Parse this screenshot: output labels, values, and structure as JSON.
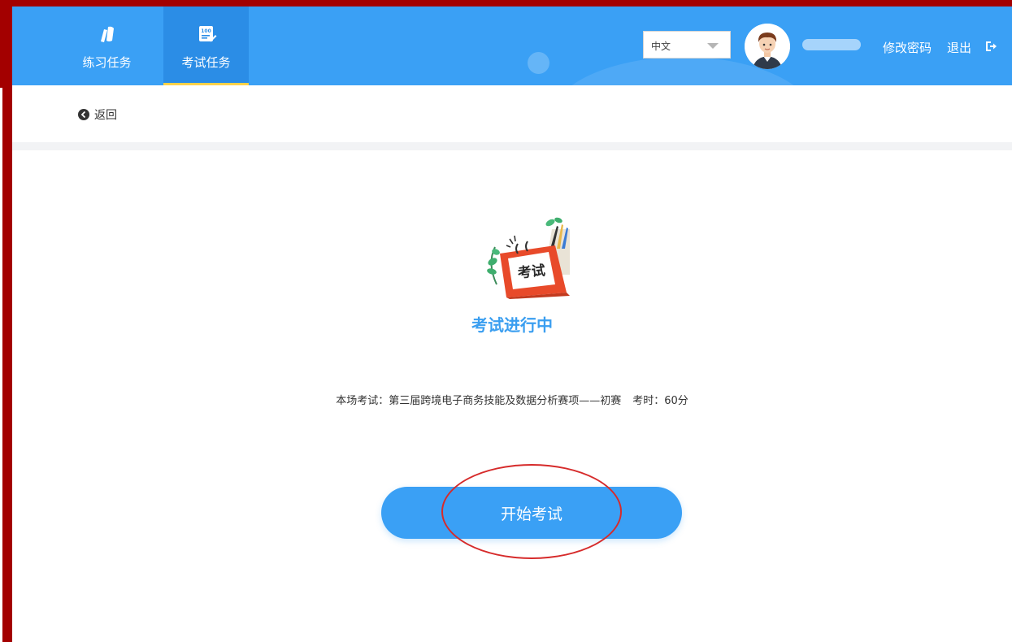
{
  "nav": {
    "tabs": [
      {
        "label": "练习任务",
        "icon": "practice-icon",
        "active": false
      },
      {
        "label": "考试任务",
        "icon": "exam-100-icon",
        "active": true
      }
    ]
  },
  "header": {
    "language": {
      "selected": "中文"
    },
    "change_password": "修改密码",
    "logout": "退出",
    "accent_color": "#3aa0f5",
    "active_tab_color": "#2b8de6",
    "active_tab_underline": "#ffd24a"
  },
  "back": {
    "label": "返回",
    "icon": "back-circle-icon"
  },
  "exam": {
    "illustration_text": "考试",
    "status": "考试进行中",
    "info_prefix": "本场考试：",
    "name": "第三届跨境电子商务技能及数据分析赛项——初赛",
    "duration_label": "考时：",
    "duration": "60分",
    "start_button": "开始考试"
  },
  "annotation": {
    "color": "#d62b2b",
    "shape": "ellipse around start button"
  }
}
